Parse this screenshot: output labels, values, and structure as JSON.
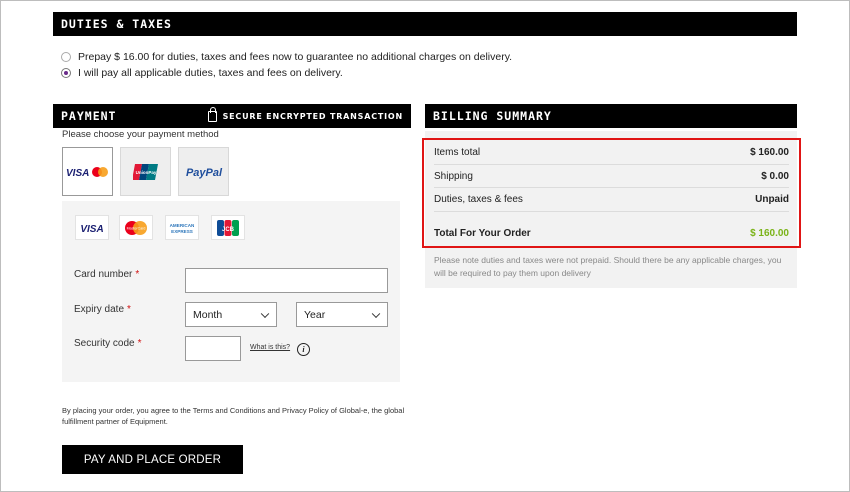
{
  "duties": {
    "title": "DUTIES & TAXES",
    "options": [
      {
        "label": "Prepay $ 16.00 for duties, taxes and fees now to guarantee no additional charges on delivery.",
        "selected": false
      },
      {
        "label": "I will pay all applicable duties, taxes and fees on delivery.",
        "selected": true
      }
    ]
  },
  "payment": {
    "title": "PAYMENT",
    "secure_label": "SECURE ENCRYPTED TRANSACTION",
    "choose_label": "Please choose your payment method",
    "methods": [
      {
        "name": "visa-mastercard",
        "label": "VISA",
        "selected": true
      },
      {
        "name": "unionpay",
        "label": "UnionPay",
        "selected": false
      },
      {
        "name": "paypal",
        "label": "PayPal",
        "selected": false
      }
    ],
    "card_logos": [
      "VISA",
      "MasterCard",
      "AMERICAN EXPRESS",
      "JCB"
    ],
    "card_number_label": "Card number",
    "expiry_label": "Expiry date",
    "security_label": "Security code",
    "required_mark": "*",
    "month_value": "Month",
    "year_value": "Year",
    "what_is_this": "What is this?",
    "info_glyph": "i",
    "terms": "By placing your order, you agree to the Terms and Conditions and Privacy Policy of Global-e, the global fulfillment partner of Equipment.",
    "pay_button": "PAY AND PLACE ORDER"
  },
  "summary": {
    "title": "BILLING SUMMARY",
    "rows": [
      {
        "label": "Items total",
        "value": "$ 160.00"
      },
      {
        "label": "Shipping",
        "value": "$ 0.00"
      },
      {
        "label": "Duties, taxes & fees",
        "value": "Unpaid"
      }
    ],
    "total_label": "Total For Your Order",
    "total_value": "$ 160.00",
    "note": "Please note duties and taxes were not prepaid. Should there be any applicable charges, you will be required to pay them upon delivery"
  },
  "colors": {
    "highlight": "#e01515",
    "total_green": "#7ab317",
    "radio_selected": "#6a2c8a"
  }
}
